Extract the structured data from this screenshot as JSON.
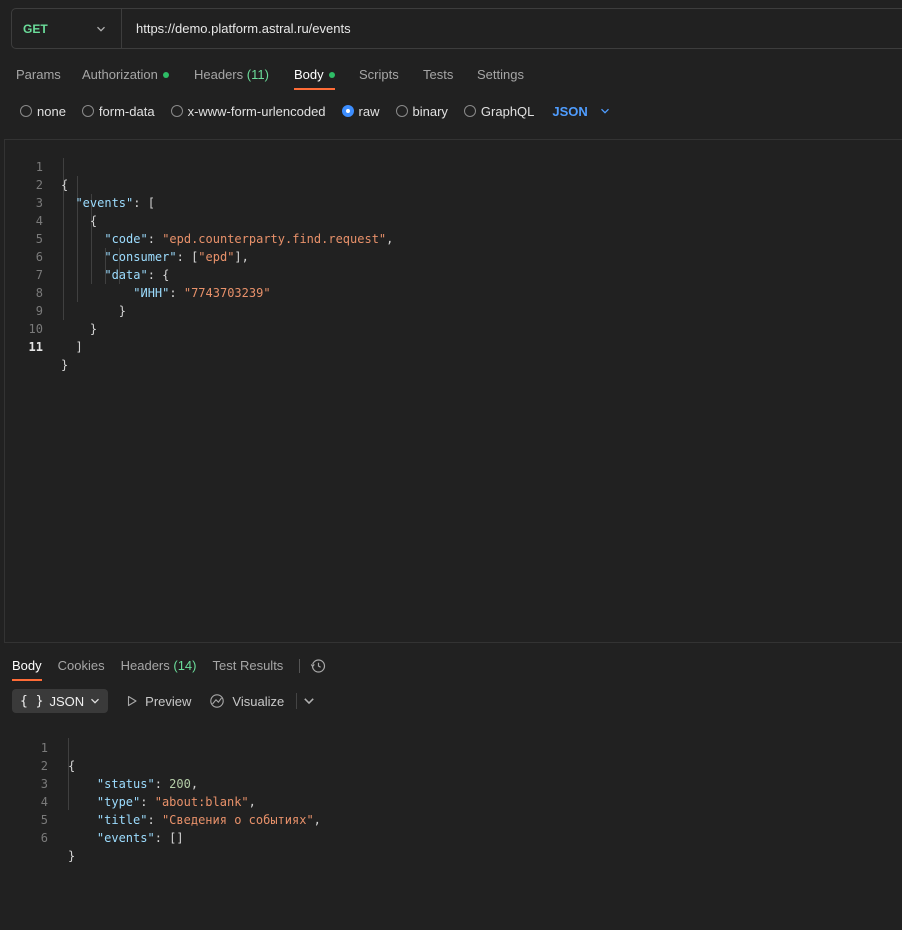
{
  "request": {
    "method": "GET",
    "url": "https://demo.platform.astral.ru/events"
  },
  "tabs": [
    {
      "label": "Params"
    },
    {
      "label": "Authorization",
      "dot": true
    },
    {
      "label": "Headers",
      "count": "(11)"
    },
    {
      "label": "Body",
      "dot": true,
      "active": true
    },
    {
      "label": "Scripts"
    },
    {
      "label": "Tests"
    },
    {
      "label": "Settings"
    }
  ],
  "body_types": [
    {
      "label": "none",
      "checked": false
    },
    {
      "label": "form-data",
      "checked": false
    },
    {
      "label": "x-www-form-urlencoded",
      "checked": false
    },
    {
      "label": "raw",
      "checked": true
    },
    {
      "label": "binary",
      "checked": false
    },
    {
      "label": "GraphQL",
      "checked": false
    }
  ],
  "body_language": "JSON",
  "request_body_lines": [
    "{",
    "  \"events\": [",
    "    {",
    "      \"code\": \"epd.counterparty.find.request\",",
    "      \"consumer\": [\"epd\"],",
    "      \"data\": {",
    "          \"ИНН\": \"7743703239\"",
    "        }",
    "    }",
    "  ]",
    "}"
  ],
  "response": {
    "tabs": [
      {
        "label": "Body",
        "active": true
      },
      {
        "label": "Cookies"
      },
      {
        "label": "Headers",
        "count": "(14)"
      },
      {
        "label": "Test Results"
      }
    ],
    "format": "JSON",
    "preview_label": "Preview",
    "visualize_label": "Visualize",
    "body_lines": [
      "{",
      "    \"status\": 200,",
      "    \"type\": \"about:blank\",",
      "    \"title\": \"Сведения о событиях\",",
      "    \"events\": []",
      "}"
    ]
  },
  "colors": {
    "method": "#6bdd9a",
    "accent_tab": "#ff6c37",
    "radio_checked": "#3d8eff",
    "json_key": "#9cdcfe",
    "json_string": "#e8916a",
    "json_number": "#b5cea8"
  },
  "icons": [
    "chevron-down-icon",
    "history-icon",
    "play-icon",
    "visualize-icon",
    "braces-icon"
  ]
}
